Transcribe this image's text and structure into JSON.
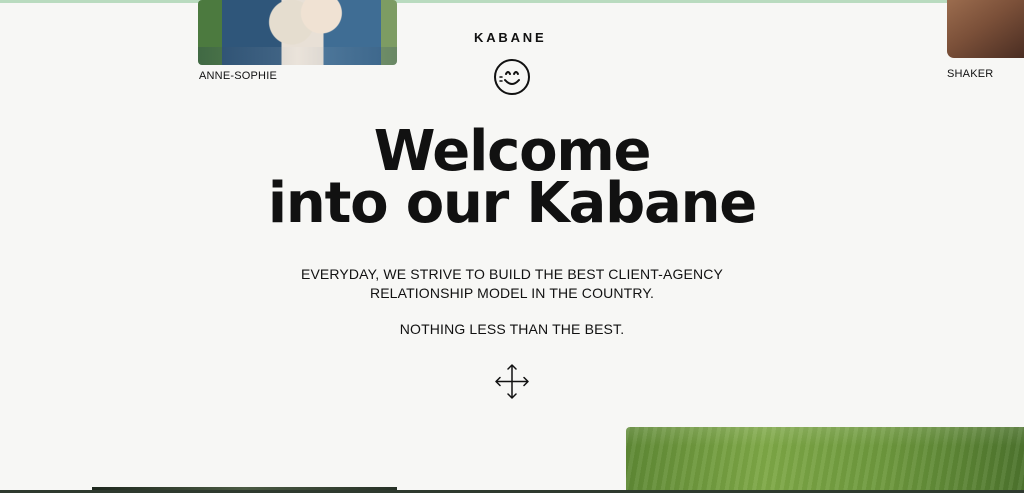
{
  "brand": {
    "name": "KABANE",
    "logo_icon": "smiley-face-icon"
  },
  "team": [
    {
      "name": "ANNE-SOPHIE"
    },
    {
      "name": "SHAKER"
    }
  ],
  "hero": {
    "headline_line1": "Welcome",
    "headline_line2": "into our Kabane",
    "paragraph1_line1": "EVERYDAY, WE STRIVE TO BUILD THE BEST CLIENT-AGENCY",
    "paragraph1_line2": "RELATIONSHIP MODEL IN THE COUNTRY.",
    "paragraph2": "NOTHING LESS THAN THE BEST.",
    "scroll_icon": "move-arrows-icon"
  },
  "colors": {
    "background": "#f7f7f5",
    "text": "#111111",
    "top_border": "#b9dbbf",
    "grass": "#6f9a3f"
  }
}
